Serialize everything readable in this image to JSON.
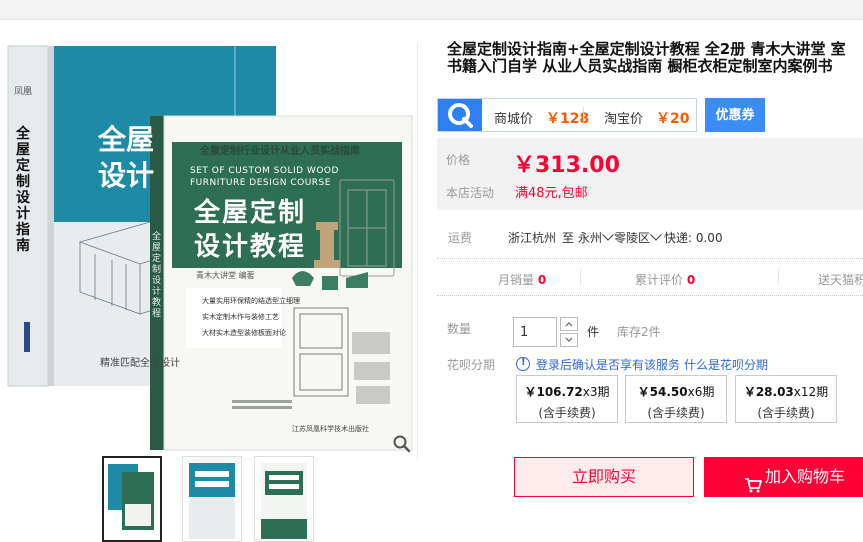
{
  "product": {
    "title_line1": "全屋定制设计指南+全屋定制设计教程 全2册 青木大讲堂 室",
    "title_line2": "书籍入门自学 从业人员实战指南 橱柜衣柜定制室内案例书"
  },
  "book_front": {
    "top_line": "全屋定制行业设计从业人员实战指南",
    "en_line1": "SET OF CUSTOM SOLID WOOD",
    "en_line2": "FURNITURE DESIGN COURSE",
    "title_line1": "全屋定制",
    "title_line2": "设计教程",
    "author": "青木大讲堂 编著",
    "bullet1": "大量实用环保精的结选型立细理",
    "bullet2": "实木定制木作与装修工艺",
    "bullet3": "大材实木造型装修板面对论",
    "publisher": "江苏凤凰科学技术出版社",
    "spine": "全屋定制设计教程"
  },
  "book_back": {
    "spine_title": "全屋定制设计指南",
    "spine_badge": "凤凰",
    "cover_title_1": "全屋",
    "cover_title_2": "设计",
    "cover_sub": "精准匹配全屋设计"
  },
  "thumbnails": [
    {
      "label": "全屋定制设计指南 全屋定制设计教程"
    },
    {
      "label": "全屋定制设计指南"
    },
    {
      "label": "全屋定制设计指南 实木教程"
    }
  ],
  "compare": {
    "mall_label": "商城价",
    "mall_price": "￥128",
    "taobao_label": "淘宝价",
    "taobao_price": "￥20"
  },
  "coupon_label": "优惠券",
  "price": {
    "label": "价格",
    "value": "￥313.00"
  },
  "promotion": {
    "label": "本店活动",
    "text": "满48元,包邮"
  },
  "shipping": {
    "label": "运费",
    "from": "浙江杭州",
    "to_word": "至",
    "city": "永州",
    "district": "零陵区",
    "express": "快递: 0.00"
  },
  "stats": {
    "monthly_label": "月销量",
    "monthly_value": "0",
    "reviews_label": "累计评价",
    "reviews_value": "0",
    "points_label": "送天猫积"
  },
  "quantity": {
    "label": "数量",
    "value": "1",
    "unit": "件",
    "stock": "库存2件"
  },
  "huabei": {
    "label": "花呗分期",
    "login_hint": "登录后确认是否享有该服务",
    "what_link": "什么是花呗分期",
    "options": [
      {
        "amount": "￥106.72",
        "periods": "x3期",
        "fee": "(含手续费)"
      },
      {
        "amount": "￥54.50",
        "periods": "x6期",
        "fee": "(含手续费)"
      },
      {
        "amount": "￥28.03",
        "periods": "x12期",
        "fee": "(含手续费)"
      }
    ]
  },
  "buttons": {
    "buy_now": "立即购买",
    "add_cart": "加入购物车"
  },
  "icons": {
    "compare": "price-compare-icon",
    "zoom": "magnifier-icon",
    "cart": "cart-icon",
    "info": "info-icon"
  },
  "colors": {
    "price_red": "#ff0036",
    "compare_orange": "#ff5a00",
    "coupon_blue": "#3b8cf5",
    "front_cover_green": "#2e6e55",
    "back_cover_teal": "#1f8aa6"
  }
}
